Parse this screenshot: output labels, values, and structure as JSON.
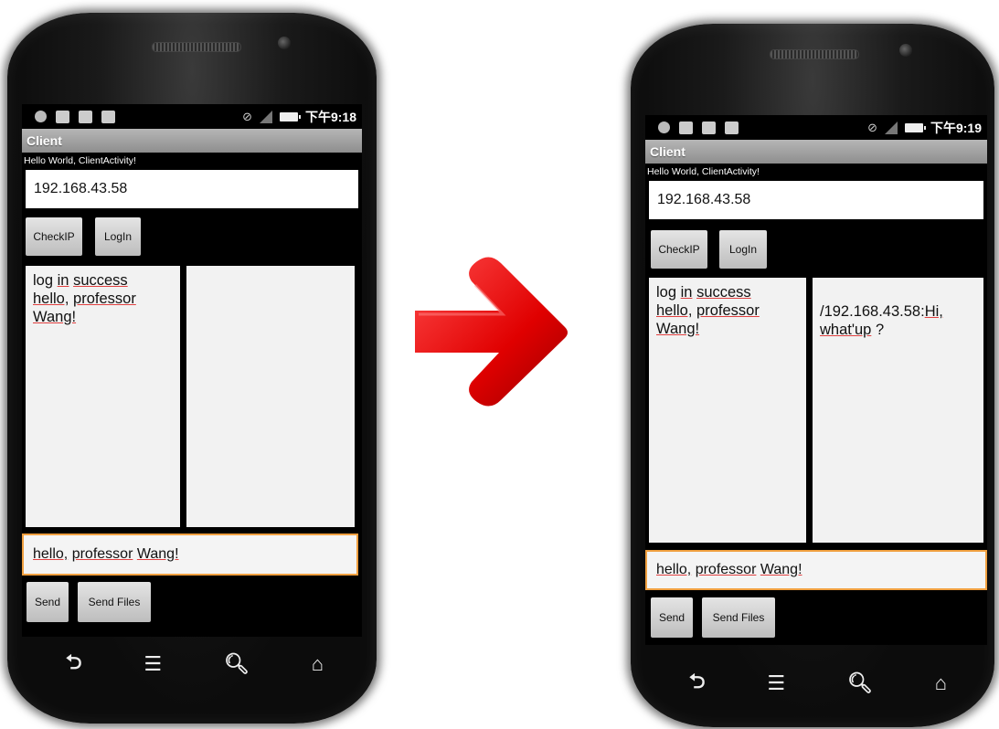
{
  "phones": [
    {
      "clock": "下午9:18",
      "app_title": "Client",
      "hello_text": "Hello World, ClientActivity!",
      "ip_value": "192.168.43.58",
      "checkip_label": "CheckIP",
      "login_label": "LogIn",
      "left_pane": [
        "log in success",
        "hello, professor",
        "Wang!"
      ],
      "right_pane": [],
      "message_value": "hello, professor Wang!",
      "send_label": "Send",
      "send_files_label": "Send Files"
    },
    {
      "clock": "下午9:19",
      "app_title": "Client",
      "hello_text": "Hello World, ClientActivity!",
      "ip_value": "192.168.43.58",
      "checkip_label": "CheckIP",
      "login_label": "LogIn",
      "left_pane": [
        "log in success",
        "hello, professor",
        "Wang!"
      ],
      "right_pane": [
        "/192.168.43.58:Hi,",
        "what'up ?"
      ],
      "message_value": "hello, professor Wang!",
      "send_label": "Send",
      "send_files_label": "Send Files"
    }
  ],
  "nav_icons": [
    "back-icon",
    "menu-icon",
    "search-icon",
    "home-icon"
  ],
  "arrow_color": "#e00000"
}
